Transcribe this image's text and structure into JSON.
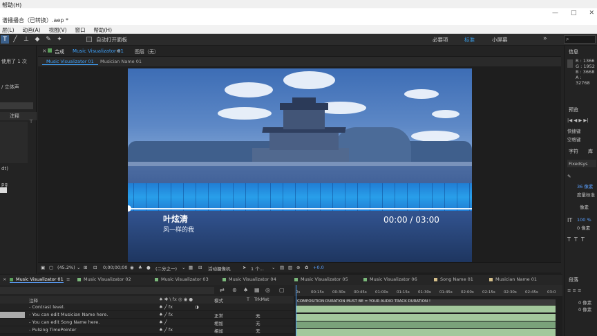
{
  "window": {
    "top_menu": "帮助(H)",
    "title": "谱播播合（已转换）.aep *",
    "win_buttons": [
      "—",
      "□",
      "✕"
    ]
  },
  "menubar": [
    "层(L)",
    "动画(A)",
    "视图(V)",
    "窗口",
    "帮助(H)"
  ],
  "toolbar": {
    "auto_open": "自动打开面板",
    "workspaces": [
      "必要项",
      "标准",
      "小屏幕"
    ],
    "active_workspace": "标准"
  },
  "left_panel": {
    "used": "使用了 1 次",
    "stereo": "/ 立体声",
    "col_comment": "注释",
    "items": [
      "dt)",
      "pg"
    ]
  },
  "comp_panel": {
    "tab_label": "合成",
    "tab_name": "Music Visualizator 01",
    "layer_tab": "图层（无）",
    "sub_tabs": [
      "Music Visualizator 01",
      "Musician Name 01"
    ]
  },
  "viewer": {
    "song": "叶炫清",
    "artist": "风一样的我",
    "time": "00:00 / 03:00",
    "progress": 0.0
  },
  "viewer_controls": {
    "zoom": "(45.2%)",
    "timecode": "0;00;00;00",
    "resolution": "(二分之一)",
    "camera": "活动摄像机",
    "views": "1 个...",
    "exposure": "+0.0"
  },
  "right_panel": {
    "info": "信息",
    "info_lines": [
      "R : 1366",
      "G : 1952",
      "B : 3668",
      "A : 32768"
    ],
    "preview": "预览",
    "shortcut": "快捷键",
    "shortcut_val": "空格键",
    "char": "字符",
    "lib": "库",
    "font": "Fixedsys",
    "size_label": "36 像素",
    "track_label": "度量标准",
    "leading": "像素",
    "scale": "100 %",
    "baseline": "0 像素",
    "para": "段落",
    "indent1": "0 像素",
    "indent2": "0 像素"
  },
  "timeline": {
    "tabs": [
      {
        "name": "Music Visualizator 01",
        "color": "#5aa05a"
      },
      {
        "name": "Music Visualizator 02",
        "color": "#7ab87a"
      },
      {
        "name": "Music Visualizator 03",
        "color": "#7ab87a"
      },
      {
        "name": "Music Visualizator 04",
        "color": "#7ab87a"
      },
      {
        "name": "Music Visualizator 05",
        "color": "#7ab87a"
      },
      {
        "name": "Music Visualizator 06",
        "color": "#7ab87a"
      },
      {
        "name": "Song Name 01",
        "color": "#d6c08a"
      },
      {
        "name": "Musician Name 01",
        "color": "#d6c08a"
      }
    ],
    "header": {
      "comment": "注释",
      "mode": "模式",
      "t": "T",
      "trkmat": "TrkMat"
    },
    "rows": [
      {
        "comment": "- Contrast level.",
        "mode": "",
        "trkmat": ""
      },
      {
        "comment": "- You can edit Musician Name here.",
        "mode": "正常",
        "trkmat": "无"
      },
      {
        "comment": "- You can edit Song Name here.",
        "mode": "相加",
        "trkmat": "无"
      },
      {
        "comment": "- Pulsing TimePointer",
        "mode": "相加",
        "trkmat": "无"
      }
    ],
    "ruler_ticks": [
      "0s",
      "00:15s",
      "00:30s",
      "00:45s",
      "01:00s",
      "01:15s",
      "01:30s",
      "01:45s",
      "02:00s",
      "02:15s",
      "02:30s",
      "02:45s",
      "03:0"
    ],
    "marker": "COMPOSITION DURATION MUST BE = YOUR AUDIO TRACK DURATION !"
  }
}
